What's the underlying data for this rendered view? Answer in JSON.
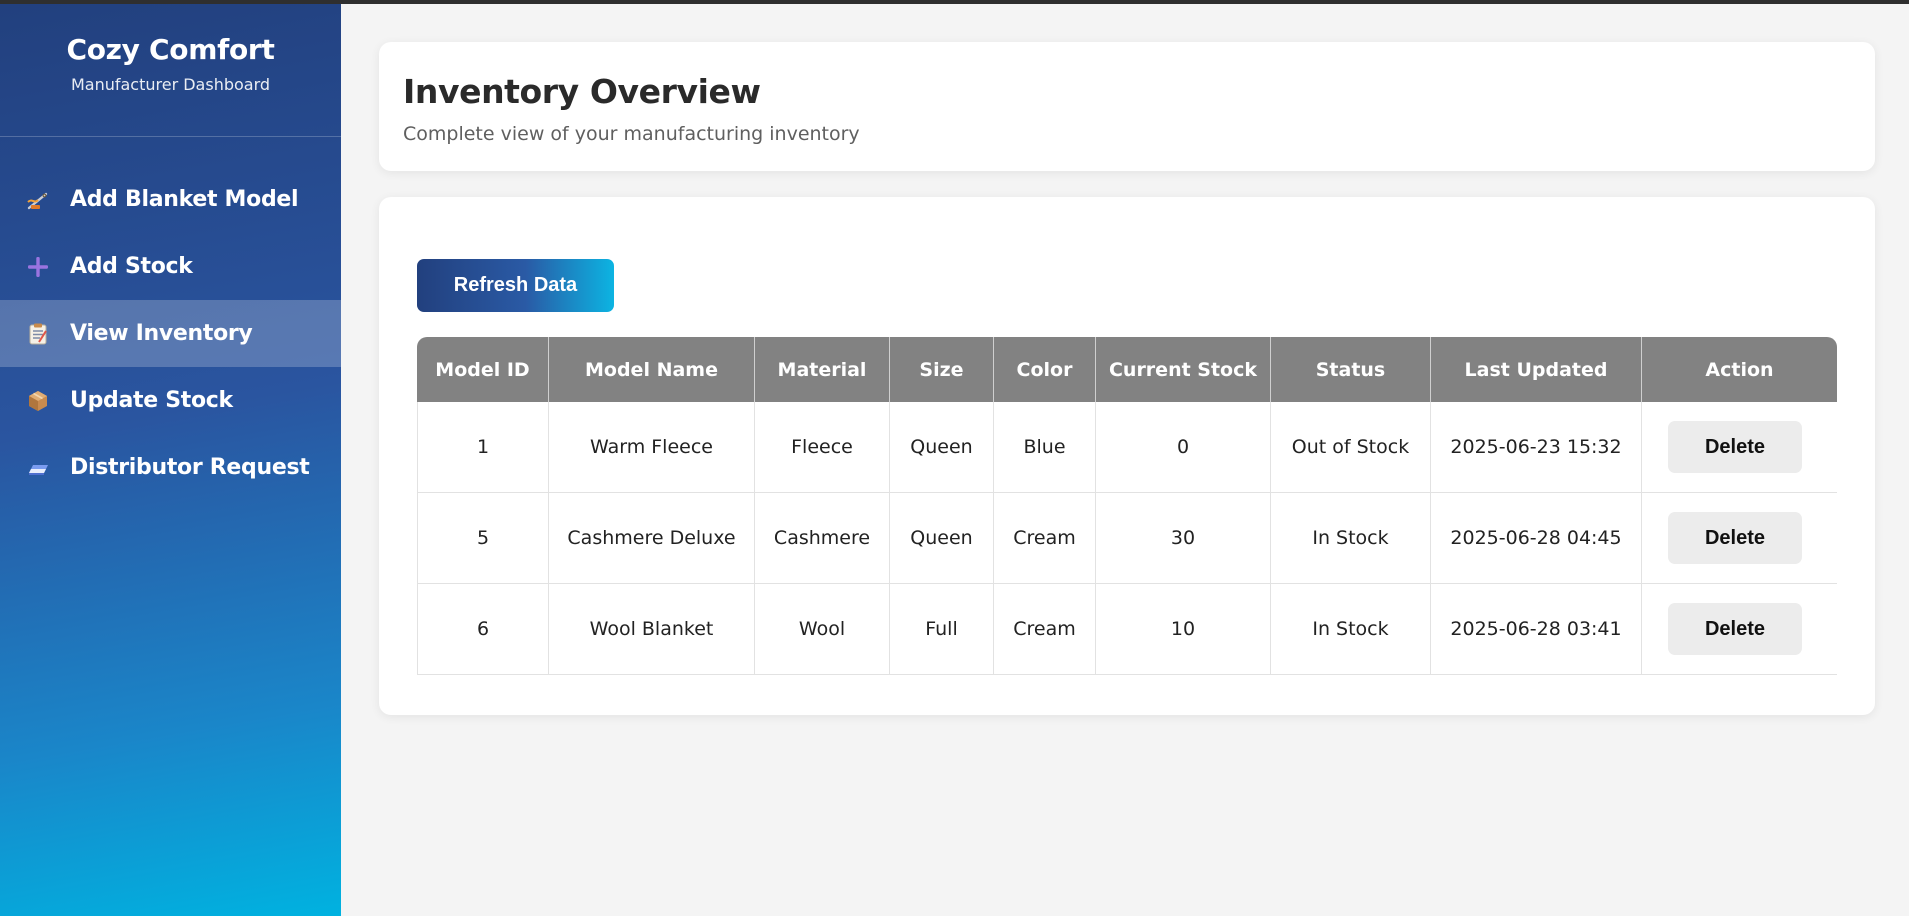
{
  "brand": {
    "title": "Cozy Comfort",
    "subtitle": "Manufacturer Dashboard"
  },
  "sidebar": {
    "items": [
      {
        "label": "Add Blanket Model",
        "icon": "sewing-needle-icon",
        "active": false
      },
      {
        "label": "Add Stock",
        "icon": "plus-icon",
        "active": false
      },
      {
        "label": "View Inventory",
        "icon": "clipboard-icon",
        "active": true
      },
      {
        "label": "Update Stock",
        "icon": "package-icon",
        "active": false
      },
      {
        "label": "Distributor Request",
        "icon": "eraser-icon",
        "active": false
      }
    ]
  },
  "header": {
    "title": "Inventory Overview",
    "subtitle": "Complete view of your manufacturing inventory"
  },
  "toolbar": {
    "refresh_label": "Refresh Data"
  },
  "table": {
    "columns": [
      "Model ID",
      "Model Name",
      "Material",
      "Size",
      "Color",
      "Current Stock",
      "Status",
      "Last Updated",
      "Action"
    ],
    "rows": [
      {
        "id": "1",
        "name": "Warm Fleece",
        "material": "Fleece",
        "size": "Queen",
        "color": "Blue",
        "stock": "0",
        "status": "Out of Stock",
        "updated": "2025-06-23 15:32",
        "action": "Delete"
      },
      {
        "id": "5",
        "name": "Cashmere Deluxe",
        "material": "Cashmere",
        "size": "Queen",
        "color": "Cream",
        "stock": "30",
        "status": "In Stock",
        "updated": "2025-06-28 04:45",
        "action": "Delete"
      },
      {
        "id": "6",
        "name": "Wool Blanket",
        "material": "Wool",
        "size": "Full",
        "color": "Cream",
        "stock": "10",
        "status": "In Stock",
        "updated": "2025-06-28 03:41",
        "action": "Delete"
      }
    ]
  },
  "colors": {
    "sidebar_top": "#22407e",
    "sidebar_bottom": "#00b2e0",
    "table_header": "#828282",
    "page_background": "#f4f4f4"
  }
}
